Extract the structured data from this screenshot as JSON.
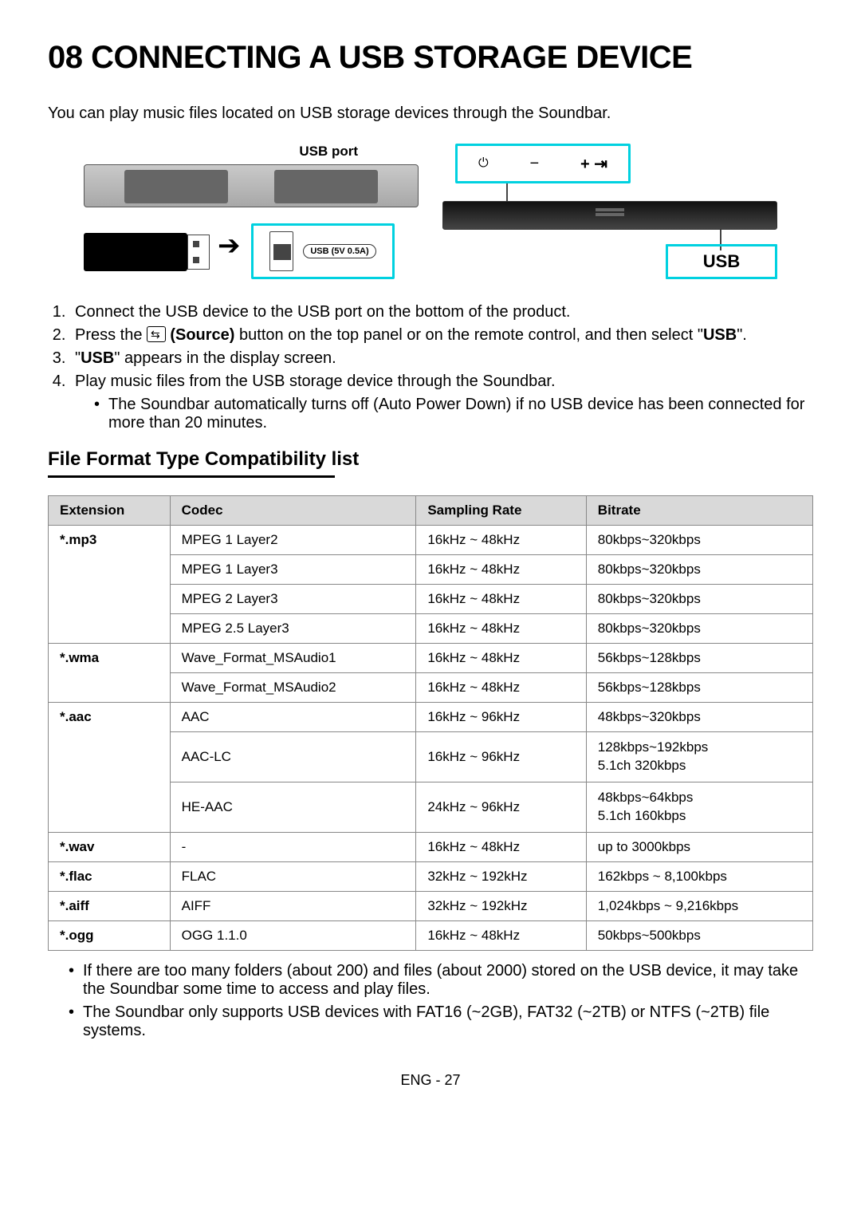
{
  "title": "08  CONNECTING A USB STORAGE DEVICE",
  "intro": "You can play music files located on USB storage devices through the Soundbar.",
  "diagram": {
    "usb_port_label": "USB port",
    "socket_label": "USB (5V 0.5A)",
    "usb_display": "USB",
    "power_glyph": "⏻",
    "minus": "−",
    "plus": "+",
    "source_glyph": "⇥"
  },
  "steps": [
    {
      "num": "1.",
      "text_a": "Connect the USB device to the USB port on the bottom of the product."
    },
    {
      "num": "2.",
      "text_a": "Press the ",
      "src_icon": "⇆⃣",
      "text_b": " (Source)",
      "text_c": " button on the top panel or on the remote control, and then select \"",
      "text_d": "USB",
      "text_e": "\"."
    },
    {
      "num": "3.",
      "text_a": "\"",
      "text_b": "USB",
      "text_c": "\" appears in the display screen."
    },
    {
      "num": "4.",
      "text_a": "Play music files from the USB storage device through the Soundbar."
    }
  ],
  "substep": "The Soundbar automatically turns off (Auto Power Down) if no USB device has been connected for more than 20 minutes.",
  "section_heading": "File Format Type Compatibility list",
  "table": {
    "headers": [
      "Extension",
      "Codec",
      "Sampling Rate",
      "Bitrate"
    ],
    "rows": [
      {
        "ext": "*.mp3",
        "ext_rowspan": 4,
        "codec": "MPEG 1 Layer2",
        "rate": "16kHz ~ 48kHz",
        "bitrate": "80kbps~320kbps"
      },
      {
        "codec": "MPEG 1 Layer3",
        "rate": "16kHz ~ 48kHz",
        "bitrate": "80kbps~320kbps"
      },
      {
        "codec": "MPEG 2 Layer3",
        "rate": "16kHz ~ 48kHz",
        "bitrate": "80kbps~320kbps"
      },
      {
        "codec": "MPEG 2.5 Layer3",
        "rate": "16kHz ~ 48kHz",
        "bitrate": "80kbps~320kbps"
      },
      {
        "ext": "*.wma",
        "ext_rowspan": 2,
        "codec": "Wave_Format_MSAudio1",
        "rate": "16kHz ~ 48kHz",
        "bitrate": "56kbps~128kbps"
      },
      {
        "codec": "Wave_Format_MSAudio2",
        "rate": "16kHz ~ 48kHz",
        "bitrate": "56kbps~128kbps"
      },
      {
        "ext": "*.aac",
        "ext_rowspan": 3,
        "codec": "AAC",
        "rate": "16kHz ~ 96kHz",
        "bitrate": "48kbps~320kbps"
      },
      {
        "codec": "AAC-LC",
        "rate": "16kHz ~ 96kHz",
        "bitrate": "128kbps~192kbps\n5.1ch 320kbps"
      },
      {
        "codec": "HE-AAC",
        "rate": "24kHz ~ 96kHz",
        "bitrate": "48kbps~64kbps\n5.1ch 160kbps"
      },
      {
        "ext": "*.wav",
        "ext_rowspan": 1,
        "codec": "-",
        "rate": "16kHz ~ 48kHz",
        "bitrate": "up to 3000kbps"
      },
      {
        "ext": "*.flac",
        "ext_rowspan": 1,
        "codec": "FLAC",
        "rate": "32kHz ~ 192kHz",
        "bitrate": "162kbps ~ 8,100kbps"
      },
      {
        "ext": "*.aiff",
        "ext_rowspan": 1,
        "codec": "AIFF",
        "rate": "32kHz ~ 192kHz",
        "bitrate": "1,024kbps ~ 9,216kbps"
      },
      {
        "ext": "*.ogg",
        "ext_rowspan": 1,
        "codec": "OGG 1.1.0",
        "rate": "16kHz ~ 48kHz",
        "bitrate": "50kbps~500kbps"
      }
    ]
  },
  "notes": [
    "If there are too many folders (about 200) and files (about 2000) stored on the USB device, it may take the Soundbar some time to access and play files.",
    "The Soundbar only supports USB devices with FAT16 (~2GB), FAT32 (~2TB) or NTFS (~2TB) file systems."
  ],
  "page_num": "ENG - 27"
}
